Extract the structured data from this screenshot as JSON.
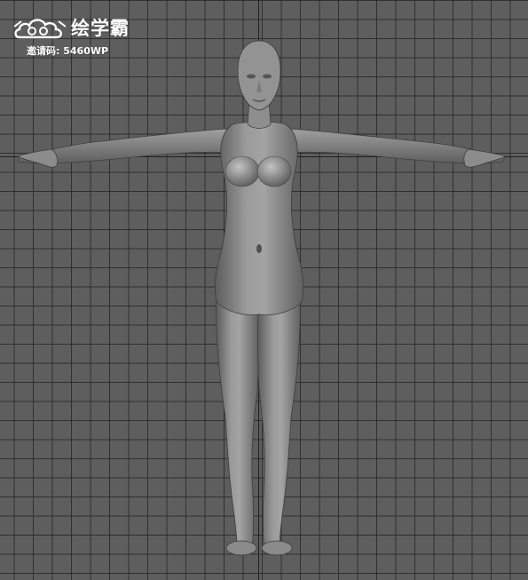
{
  "watermark": {
    "brand": "绘学霸",
    "invite_label": "邀请码:",
    "invite_code": "5460WP"
  },
  "colors": {
    "background": "#5e5e5e",
    "grid_line": "#282828",
    "axis_line": "#202020",
    "model_body": "#8a8a8a",
    "text": "#ffffff"
  },
  "icons": {
    "logo": "cloud-swirl-logo-icon"
  }
}
